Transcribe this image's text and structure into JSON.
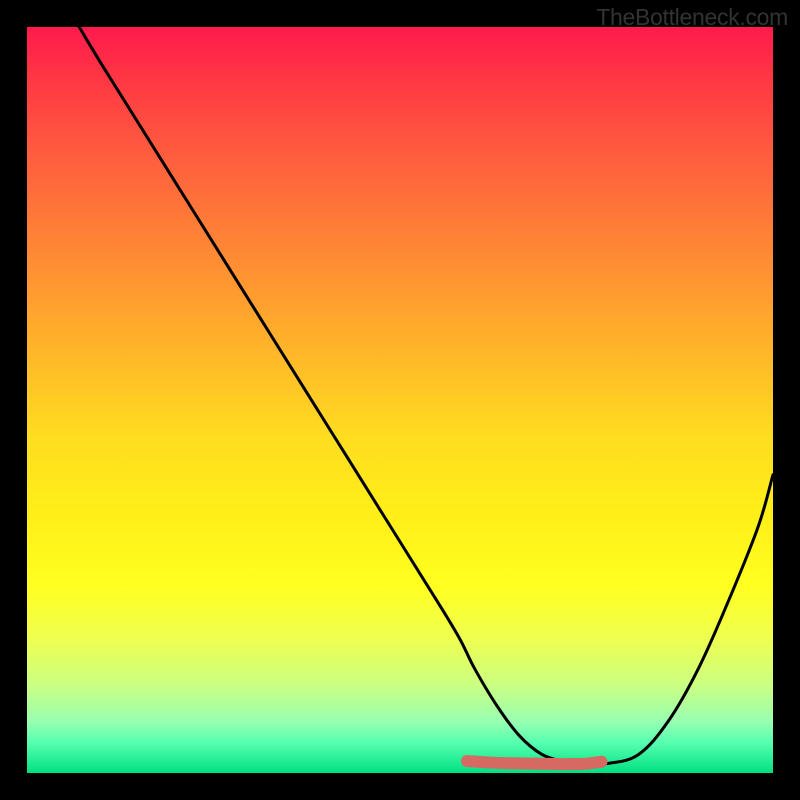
{
  "watermark": "TheBottleneck.com",
  "chart_data": {
    "type": "line",
    "title": "",
    "xlabel": "",
    "ylabel": "",
    "xlim": [
      0,
      100
    ],
    "ylim": [
      0,
      100
    ],
    "series": [
      {
        "name": "curve",
        "color": "#000000",
        "x": [
          7,
          10,
          15,
          20,
          25,
          30,
          35,
          40,
          45,
          50,
          55,
          58,
          60,
          63,
          66,
          69,
          72,
          73,
          75,
          78,
          82,
          86,
          90,
          94,
          98,
          100
        ],
        "y": [
          100,
          95,
          87,
          79,
          71,
          63,
          55,
          47,
          39,
          31,
          23,
          18,
          14,
          9,
          5,
          2.5,
          1.5,
          1.3,
          1.2,
          1.3,
          2.5,
          7,
          14,
          23,
          33,
          40
        ]
      },
      {
        "name": "floor-band",
        "color": "#d66a62",
        "x": [
          59,
          62,
          65,
          68,
          71,
          73,
          75,
          77
        ],
        "y": [
          1.6,
          1.4,
          1.3,
          1.25,
          1.2,
          1.2,
          1.25,
          1.5
        ]
      }
    ]
  }
}
